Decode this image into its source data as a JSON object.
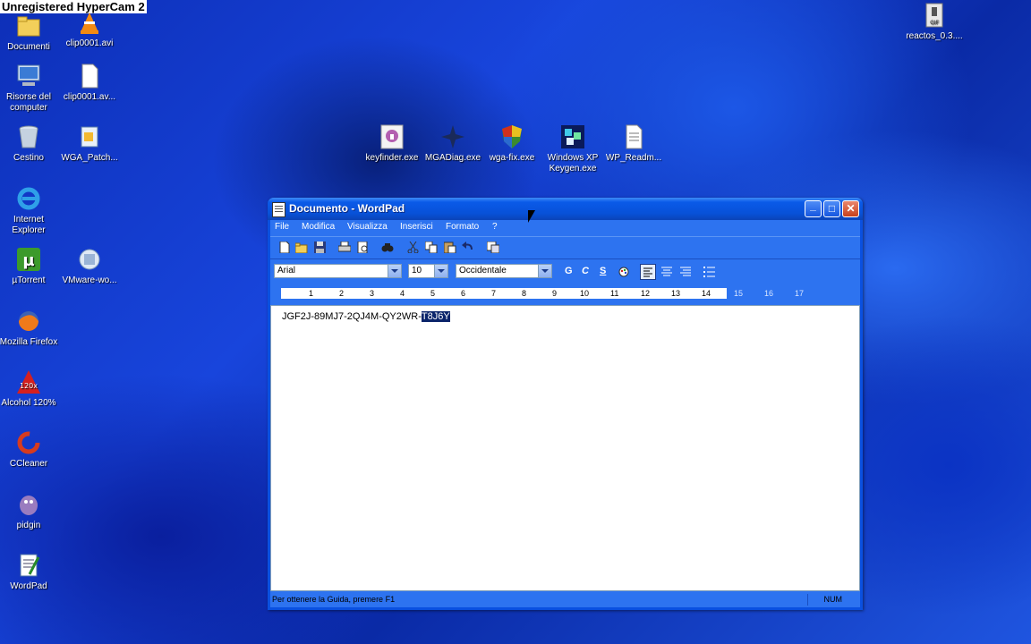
{
  "overlay": {
    "watermark": "Unregistered HyperCam 2"
  },
  "desktop": {
    "icons": [
      {
        "label": "Documenti",
        "icon": "folder-icon"
      },
      {
        "label": "clip0001.avi",
        "icon": "vlc-icon"
      },
      {
        "label": "Risorse del computer",
        "icon": "computer-icon"
      },
      {
        "label": "clip0001.av...",
        "icon": "file-icon"
      },
      {
        "label": "Cestino",
        "icon": "recycle-bin-icon"
      },
      {
        "label": "WGA_Patch...",
        "icon": "patch-icon"
      },
      {
        "label": "Internet Explorer",
        "icon": "ie-icon"
      },
      {
        "label": "µTorrent",
        "icon": "utorrent-icon"
      },
      {
        "label": "VMware-wo...",
        "icon": "vmware-icon"
      },
      {
        "label": "Mozilla Firefox",
        "icon": "firefox-icon"
      },
      {
        "label": "Alcohol 120%",
        "icon": "alcohol-icon"
      },
      {
        "label": "CCleaner",
        "icon": "ccleaner-icon"
      },
      {
        "label": "pidgin",
        "icon": "pidgin-icon"
      },
      {
        "label": "WordPad",
        "icon": "wordpad-icon"
      },
      {
        "label": "keyfinder.exe",
        "icon": "keyfinder-icon"
      },
      {
        "label": "MGADiag.exe",
        "icon": "mgadiag-icon"
      },
      {
        "label": "wga-fix.exe",
        "icon": "shield-icon"
      },
      {
        "label": "Windows XP Keygen.exe",
        "icon": "keygen-icon"
      },
      {
        "label": "WP_Readm...",
        "icon": "text-file-icon"
      },
      {
        "label": "reactos_0.3....",
        "icon": "archive-icon"
      }
    ]
  },
  "window": {
    "title": "Documento - WordPad",
    "controls": {
      "minimize": "_",
      "maximize": "□",
      "close": "✕"
    },
    "menu": [
      "File",
      "Modifica",
      "Visualizza",
      "Inserisci",
      "Formato",
      "?"
    ],
    "toolbar": [
      "new-icon",
      "open-icon",
      "save-icon",
      "print-icon",
      "print-preview-icon",
      "find-icon",
      "cut-icon",
      "copy-icon",
      "paste-icon",
      "undo-icon",
      "datetime-icon"
    ],
    "format": {
      "font": "Arial",
      "size": "10",
      "script": "Occidentale",
      "bold": "G",
      "italic": "C",
      "underline": "S"
    },
    "ruler": [
      "1",
      "2",
      "3",
      "4",
      "5",
      "6",
      "7",
      "8",
      "9",
      "10",
      "11",
      "12",
      "13",
      "14",
      "15",
      "16",
      "17"
    ],
    "document": {
      "text_plain": "JGF2J-89MJ7-2QJ4M-QY2WR-",
      "text_selected": "T8J6Y"
    },
    "status": {
      "hint": "Per ottenere la Guida, premere F1",
      "num": "NUM"
    }
  },
  "colors": {
    "title_blue": "#0a5ae8",
    "body_blue": "#2d73f0",
    "selection": "#0a246a"
  }
}
